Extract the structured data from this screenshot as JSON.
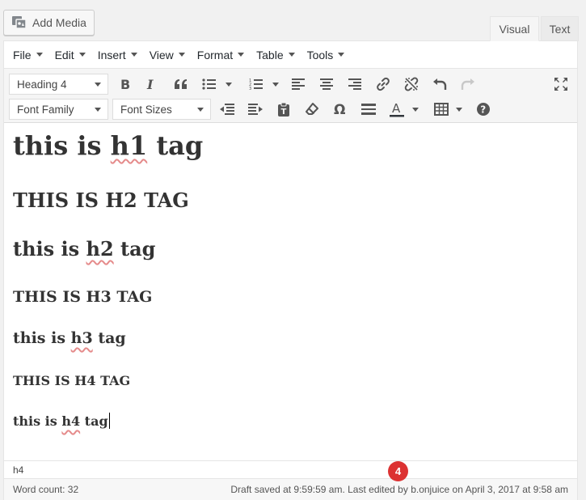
{
  "add_media": {
    "label": "Add Media"
  },
  "tabs": {
    "visual": "Visual",
    "text": "Text"
  },
  "menubar": [
    {
      "label": "File"
    },
    {
      "label": "Edit"
    },
    {
      "label": "Insert"
    },
    {
      "label": "View"
    },
    {
      "label": "Format"
    },
    {
      "label": "Table"
    },
    {
      "label": "Tools"
    }
  ],
  "toolbar": {
    "format_select": "Heading 4",
    "font_family": "Font Family",
    "font_sizes": "Font Sizes"
  },
  "content": {
    "h1": {
      "pre": "this is ",
      "mis": "h1",
      "post": " tag"
    },
    "h2a": "THIS IS H2 TAG",
    "h2b": {
      "pre": "this is ",
      "mis": "h2",
      "post": " tag"
    },
    "h3a": "THIS IS H3 TAG",
    "h3b": {
      "pre": "this is ",
      "mis": "h3",
      "post": " tag"
    },
    "h4a": "THIS IS H4 TAG",
    "h4b": {
      "pre": "this is ",
      "mis": "h4",
      "post": " tag"
    }
  },
  "badge": "4",
  "path": "h4",
  "status": {
    "word_count": "Word count: 32",
    "draft": "Draft saved at 9:59:59 am. Last edited by b.onjuice on April 3, 2017 at 9:58 am"
  },
  "colors": {
    "badge": "#dc3232",
    "spellcheck": "#e58b8b"
  }
}
